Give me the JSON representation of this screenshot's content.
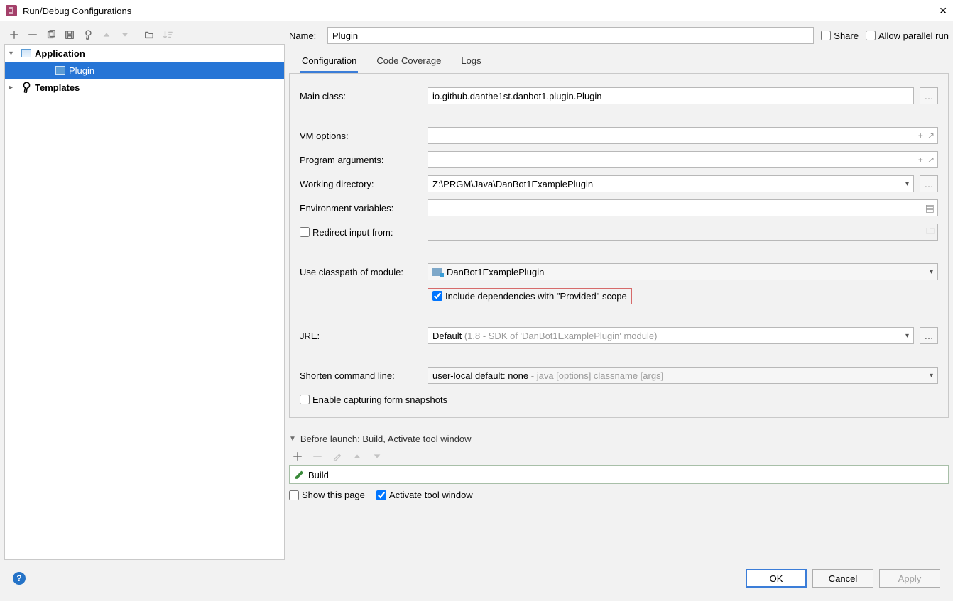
{
  "window": {
    "title": "Run/Debug Configurations"
  },
  "tree": {
    "application": "Application",
    "plugin": "Plugin",
    "templates": "Templates"
  },
  "name_row": {
    "label": "Name:",
    "value": "Plugin",
    "share": "Share",
    "parallel": "Allow parallel run"
  },
  "tabs": {
    "config": "Configuration",
    "coverage": "Code Coverage",
    "logs": "Logs"
  },
  "form": {
    "main_class_label": "Main class:",
    "main_class": "io.github.danthe1st.danbot1.plugin.Plugin",
    "vm_label": "VM options:",
    "args_label": "Program arguments:",
    "cwd_label": "Working directory:",
    "cwd": "Z:\\PRGM\\Java\\DanBot1ExamplePlugin",
    "env_label": "Environment variables:",
    "redirect_label": "Redirect input from:",
    "classpath_label": "Use classpath of module:",
    "classpath_value": "DanBot1ExamplePlugin",
    "include_deps": "Include dependencies with \"Provided\" scope",
    "jre_label": "JRE:",
    "jre_default": "Default ",
    "jre_hint": "(1.8 - SDK of 'DanBot1ExamplePlugin' module)",
    "shorten_label": "Shorten command line:",
    "shorten_value": "user-local default: none ",
    "shorten_hint": "- java [options] classname [args]",
    "snapshots": "Enable capturing form snapshots"
  },
  "before_launch": {
    "header": "Before launch: Build, Activate tool window",
    "build": "Build",
    "show_page": "Show this page",
    "activate": "Activate tool window"
  },
  "buttons": {
    "ok": "OK",
    "cancel": "Cancel",
    "apply": "Apply"
  }
}
